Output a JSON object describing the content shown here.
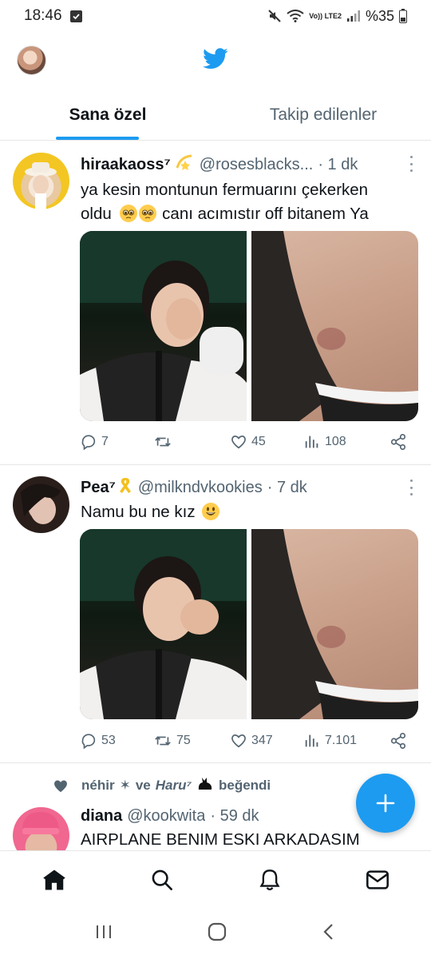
{
  "status_bar": {
    "time": "18:46",
    "network_label": "Vo)) LTE2",
    "battery": "%35"
  },
  "tabs": [
    {
      "label": "Sana özel",
      "active": true
    },
    {
      "label": "Takip edilenler",
      "active": false
    }
  ],
  "tweets": [
    {
      "name": "hiraakaoss⁷",
      "handle": "@rosesblacks...",
      "time": "· 1 dk",
      "text_line1": "ya kesin montunun fermuarını çekerken",
      "text_line2_before": "oldu",
      "text_line2_after": "canı acımıstır off bitanem Ya",
      "emojis": [
        "pleading-face-emoji",
        "pleading-face-emoji"
      ],
      "stats": {
        "replies": "7",
        "retweets": "",
        "likes": "45",
        "views": "108"
      }
    },
    {
      "name": "Pea⁷",
      "handle": "@milkndvkookies",
      "time": "· 7 dk",
      "text": "Namu bu ne kız",
      "emojis": [
        "grinning-face-emoji"
      ],
      "stats": {
        "replies": "53",
        "retweets": "75",
        "likes": "347",
        "views": "7.101"
      }
    },
    {
      "liked_by_1": "néhir",
      "liked_by_2": "Haru⁷",
      "liked_by_and": "ve",
      "liked_suffix": "beğendi",
      "name": "diana",
      "handle": "@kookwita",
      "time": "· 59 dk",
      "text": "AIRPLANE BENIM ESKI ARKADASIM"
    }
  ],
  "icons": {
    "brand": "twitter-bird-icon",
    "nav": [
      "home-icon",
      "search-icon",
      "notifications-bell-icon",
      "messages-mail-icon"
    ],
    "fab": "compose-plus-icon"
  },
  "colors": {
    "accent": "#1d9bf0",
    "text_primary": "#0f1419",
    "text_secondary": "#536471"
  }
}
